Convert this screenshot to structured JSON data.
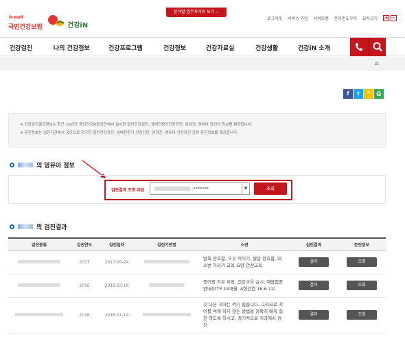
{
  "header": {
    "top_button": "분야별 업무사이트 보기 ⌄",
    "logo1_tag": "h-well",
    "logo1_name": "국민건강보험",
    "logo2_name": "건강iN",
    "utils": [
      "로그아웃",
      "서비스 가입",
      "사이트맵",
      "온라인도우미",
      "글자크기"
    ],
    "font_plus": "+",
    "font_minus": "−"
  },
  "nav": {
    "items": [
      "건강검진",
      "나의 건강정보",
      "건강프로그램",
      "건강정보",
      "건강자료실",
      "건강생활",
      "건강iN 소개"
    ]
  },
  "breadcrumb": {
    "home_icon": "⌂"
  },
  "share": {
    "facebook": "f",
    "twitter": "t",
    "kakao": "❞",
    "print": "⎙"
  },
  "notice": {
    "line1": "※ 건강검진결과정보는 최근 10년간 국민건강보험공단에서 실시한 일반건강검진, 생애전환기건강진단, 암검진, 영유아 검진의 정보를 제공합니다.",
    "line2": "※ 문진정보는 검진기관에서 공단으로 청구한 일반건강검진, 생애전환기 건강진단, 암검진, 영유아 건강검진 관련 문진정보를 제공합니다."
  },
  "section1": {
    "title_suffix": "의 영유아 정보"
  },
  "lookup": {
    "label": "검진결과 조회 대상",
    "select_value": "-*******",
    "button": "조회"
  },
  "section2": {
    "title_suffix": "의 검진결과"
  },
  "table": {
    "headers": [
      "검진종류",
      "검진연도",
      "검진일자",
      "검진기관명",
      "소견",
      "검진결과",
      "문진정보"
    ],
    "rows": [
      {
        "year": "2017",
        "date": "2017-05-24",
        "finding": "발육 양호함, 우유 먹이기, 발달 양호함, 대소변 가리기 교육 요망 안전교육",
        "result_btn": "결과",
        "survey_btn": "조회"
      },
      {
        "year": "2016",
        "date": "2016-03-18",
        "finding": "종이명 지료 요망, 건강교육 실시, 예방접종안내(DTP 18개월, A형간염 16.6.12)",
        "result_btn": "결과",
        "survey_btn": "조회"
      },
      {
        "year": "2016",
        "date": "2016-01-14",
        "finding": "갓 나온 치아는 썩기 쉽습니다. 그러므로 치아를 썩게 하지 않는 방법을 정확히 배워 실천 하도록 하시고, 정기적으로 치과에서 검진",
        "result_btn": "결과",
        "survey_btn": "조회"
      }
    ]
  },
  "colors": {
    "brand_red": "#c4161c",
    "accent_blue": "#1a5fa8"
  }
}
